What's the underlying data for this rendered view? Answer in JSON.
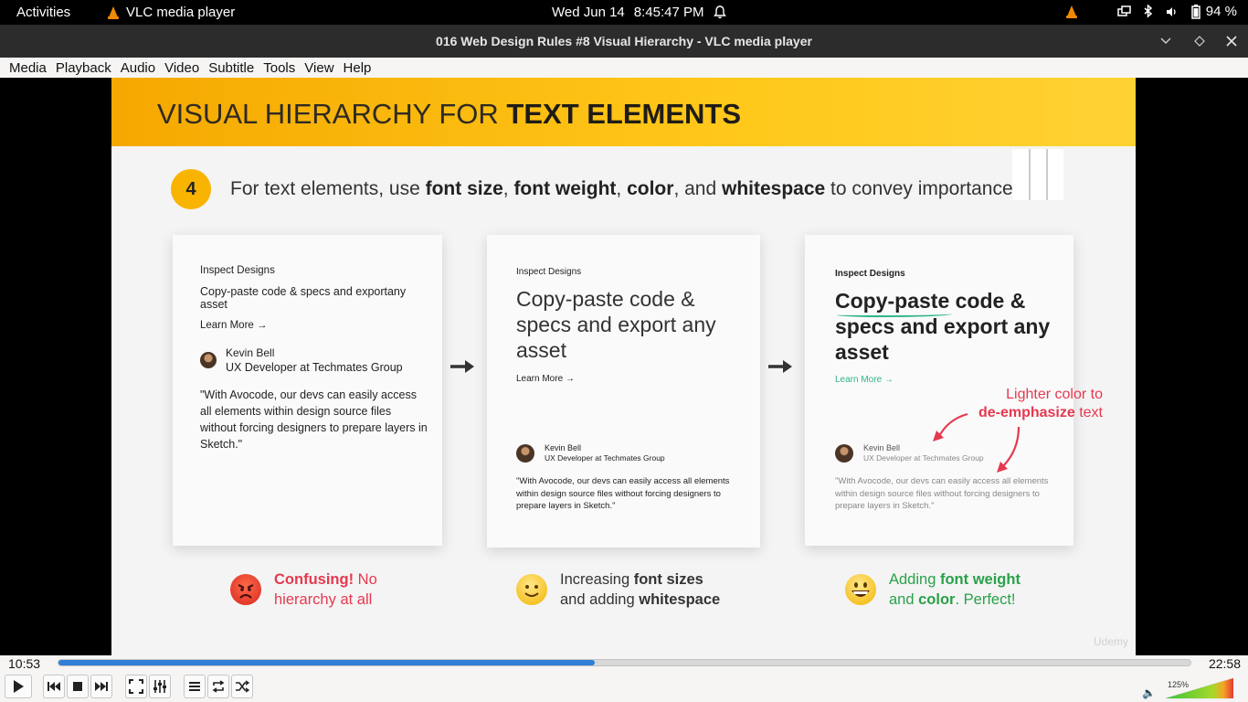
{
  "topbar": {
    "activities": "Activities",
    "app_name": "VLC media player",
    "date": "Wed Jun 14",
    "time": "8:45:47 PM",
    "battery": "94 %"
  },
  "window": {
    "title": "016 Web Design Rules #8 Visual Hierarchy - VLC media player"
  },
  "menu": [
    "Media",
    "Playback",
    "Audio",
    "Video",
    "Subtitle",
    "Tools",
    "View",
    "Help"
  ],
  "slide": {
    "title_light": "VISUAL HIERARCHY FOR ",
    "title_bold": "TEXT ELEMENTS",
    "step_number": "4",
    "step_text": {
      "t1": "For text elements, use ",
      "b1": "font size",
      "t2": ", ",
      "b2": "font weight",
      "t3": ", ",
      "b3": "color",
      "t4": ", and ",
      "b4": "whitespace",
      "t5": " to convey importance"
    },
    "card": {
      "label": "Inspect Designs",
      "head1": "Copy-paste code & specs and exportany asset",
      "head2": "Copy-paste code & specs and export any asset",
      "head3_underlined": "Copy-paste",
      "head3_rest": " code & specs and export any asset",
      "learn_more": "Learn More",
      "name": "Kevin Bell",
      "role": "UX Developer at Techmates Group",
      "quote": "\"With Avocode, our devs can easily access all elements within design source files without forcing designers to prepare layers in Sketch.\""
    },
    "annotation": {
      "line1": "Lighter color to",
      "bold": "de-emphasize",
      "rest": " text"
    },
    "captions": {
      "c1_bold": "Confusing!",
      "c1_rest1": " No",
      "c1_rest2": "hierarchy at all",
      "c2_t1": "Increasing ",
      "c2_b1": "font sizes",
      "c2_t2": "and adding ",
      "c2_b2": "whitespace",
      "c3_t1": "Adding ",
      "c3_b1": "font weight",
      "c3_t2": "and ",
      "c3_b2": "color",
      "c3_t3": ". Perfect!"
    },
    "watermark": "Udemy"
  },
  "player": {
    "elapsed": "10:53",
    "total": "22:58",
    "progress": 0.474,
    "volume": "125%",
    "accent": "#2f7fd6"
  }
}
